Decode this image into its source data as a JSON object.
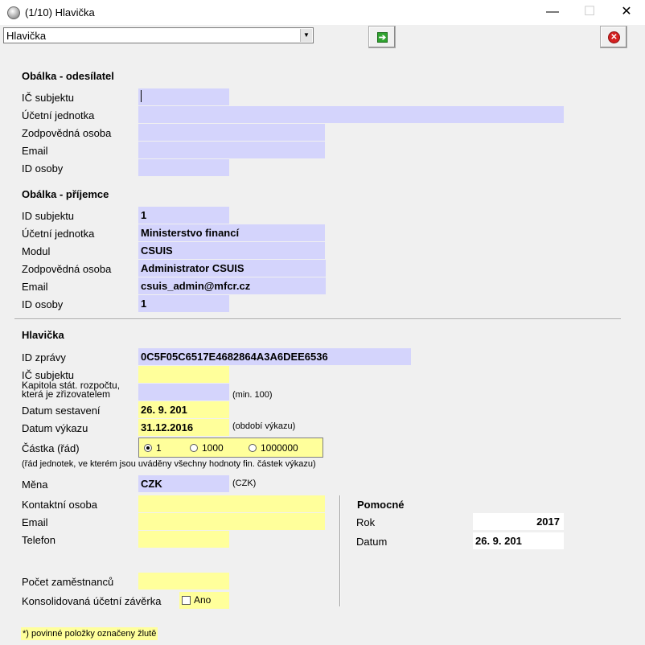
{
  "window": {
    "title": "(1/10) Hlavička",
    "minimize": "—",
    "maximize": "☐",
    "close": "✕"
  },
  "toolbar": {
    "combo_value": "Hlavička",
    "combo_arrow": "▼",
    "go_glyph": "➔",
    "cancel_glyph": "✕"
  },
  "sender": {
    "heading": "Obálka - odesílatel",
    "ic_label": "IČ subjektu",
    "ic_value": "",
    "unit_label": "Účetní jednotka",
    "unit_value": "",
    "person_label": "Zodpovědná osoba",
    "person_value": "",
    "email_label": "Email",
    "email_value": "",
    "id_label": "ID osoby",
    "id_value": ""
  },
  "recipient": {
    "heading": "Obálka - příjemce",
    "subject_label": "ID subjektu",
    "subject_value": "1",
    "unit_label": "Účetní jednotka",
    "unit_value": "Ministerstvo financí",
    "module_label": "Modul",
    "module_value": "CSUIS",
    "person_label": "Zodpovědná osoba",
    "person_value": "Administrator CSUIS",
    "email_label": "Email",
    "email_value": "csuis_admin@mfcr.cz",
    "id_label": "ID osoby",
    "id_value": "1"
  },
  "header": {
    "heading": "Hlavička",
    "msg_label": "ID zprávy",
    "msg_value": "0C5F05C6517E4682864A3A6DEE6536",
    "ic_label": "IČ subjektu",
    "ic_value": "",
    "chapter_label_1": "Kapitola stát. rozpočtu,",
    "chapter_label_2": "která je zřizovatelem",
    "chapter_value": "",
    "chapter_hint": "(min. 100)",
    "date_label": "Datum sestavení",
    "date_value": "26. 9. 201",
    "report_date_label": "Datum výkazu",
    "report_date_value": "31.12.2016",
    "report_date_hint": "(období výkazu)",
    "amount_label": "Částka (řád)",
    "amount_options": [
      "1",
      "1000",
      "1000000"
    ],
    "amount_selected": "1",
    "amount_note": "(řád jednotek, ve kterém jsou uváděny všechny hodnoty fin. částek výkazu)",
    "currency_label": "Měna",
    "currency_value": "CZK",
    "currency_hint": "(CZK)",
    "contact_label": "Kontaktní osoba",
    "contact_value": "",
    "email_label": "Email",
    "email_value": "",
    "phone_label": "Telefon",
    "phone_value": "",
    "employees_label": "Počet zaměstnanců",
    "employees_value": "",
    "consolidated_label": "Konsolidovaná účetní závěrka",
    "consolidated_check_label": "Ano",
    "consolidated_checked": false
  },
  "helper": {
    "heading": "Pomocné",
    "year_label": "Rok",
    "year_value": "2017",
    "date_label": "Datum",
    "date_value": "26. 9. 201"
  },
  "footnote": "*) povinné položky označeny žlutě"
}
